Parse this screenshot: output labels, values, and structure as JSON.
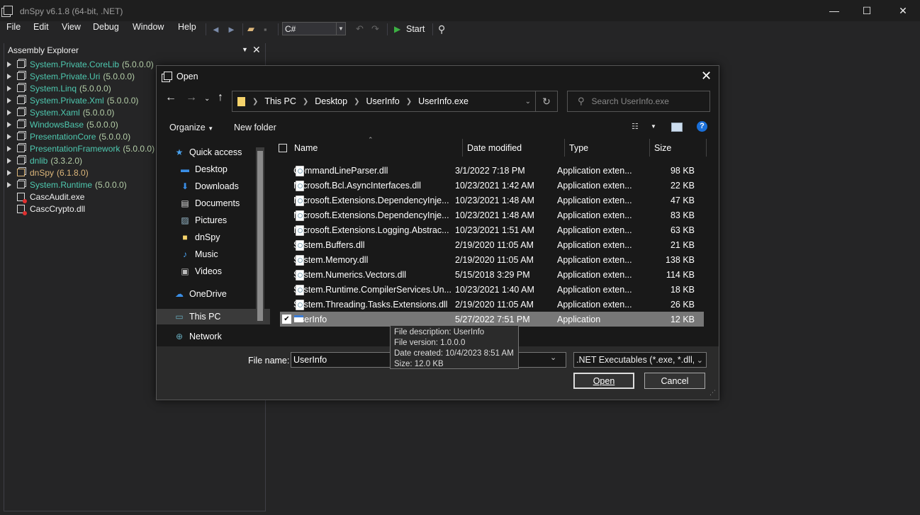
{
  "window": {
    "title": "dnSpy v6.1.8 (64-bit, .NET)",
    "minimize": "—",
    "maximize": "☐",
    "close": "✕"
  },
  "menu": [
    "File",
    "Edit",
    "View",
    "Debug",
    "Window",
    "Help"
  ],
  "toolbar": {
    "language": "C#",
    "start_label": "Start"
  },
  "explorer": {
    "title": "Assembly Explorer",
    "items": [
      {
        "name": "System.Private.CoreLib",
        "version": "(5.0.0.0)",
        "kind": "asm"
      },
      {
        "name": "System.Private.Uri",
        "version": "(5.0.0.0)",
        "kind": "asm"
      },
      {
        "name": "System.Linq",
        "version": "(5.0.0.0)",
        "kind": "asm"
      },
      {
        "name": "System.Private.Xml",
        "version": "(5.0.0.0)",
        "kind": "asm"
      },
      {
        "name": "System.Xaml",
        "version": "(5.0.0.0)",
        "kind": "asm"
      },
      {
        "name": "WindowsBase",
        "version": "(5.0.0.0)",
        "kind": "asm"
      },
      {
        "name": "PresentationCore",
        "version": "(5.0.0.0)",
        "kind": "asm"
      },
      {
        "name": "PresentationFramework",
        "version": "(5.0.0.0)",
        "kind": "asm"
      },
      {
        "name": "dnlib",
        "version": "(3.3.2.0)",
        "kind": "asm"
      },
      {
        "name": "dnSpy",
        "version": "(6.1.8.0)",
        "kind": "asm-yellow"
      },
      {
        "name": "System.Runtime",
        "version": "(5.0.0.0)",
        "kind": "asm"
      },
      {
        "name": "CascAudit.exe",
        "version": "",
        "kind": "err"
      },
      {
        "name": "CascCrypto.dll",
        "version": "",
        "kind": "err"
      }
    ]
  },
  "dialog": {
    "title": "Open",
    "breadcrumb": [
      "This PC",
      "Desktop",
      "UserInfo",
      "UserInfo.exe"
    ],
    "search_placeholder": "Search UserInfo.exe",
    "organize": "Organize",
    "new_folder": "New folder",
    "nav": [
      {
        "label": "Quick access",
        "icon": "star-icon",
        "pinned": false
      },
      {
        "label": "Desktop",
        "icon": "desktop-icon",
        "pinned": true
      },
      {
        "label": "Downloads",
        "icon": "download-icon",
        "pinned": true
      },
      {
        "label": "Documents",
        "icon": "document-icon",
        "pinned": true
      },
      {
        "label": "Pictures",
        "icon": "picture-icon",
        "pinned": true
      },
      {
        "label": "dnSpy",
        "icon": "folder-icon",
        "pinned": false
      },
      {
        "label": "Music",
        "icon": "music-icon",
        "pinned": false
      },
      {
        "label": "Videos",
        "icon": "video-icon",
        "pinned": false
      },
      {
        "label": "OneDrive",
        "icon": "cloud-icon",
        "pinned": false
      },
      {
        "label": "This PC",
        "icon": "pc-icon",
        "pinned": false
      },
      {
        "label": "Network",
        "icon": "network-icon",
        "pinned": false
      }
    ],
    "columns": {
      "name": "Name",
      "date": "Date modified",
      "type": "Type",
      "size": "Size"
    },
    "files": [
      {
        "name": "CommandLineParser.dll",
        "date": "3/1/2022 7:18 PM",
        "type": "Application exten...",
        "size": "98 KB"
      },
      {
        "name": "Microsoft.Bcl.AsyncInterfaces.dll",
        "date": "10/23/2021 1:42 AM",
        "type": "Application exten...",
        "size": "22 KB"
      },
      {
        "name": "Microsoft.Extensions.DependencyInje...",
        "date": "10/23/2021 1:48 AM",
        "type": "Application exten...",
        "size": "47 KB"
      },
      {
        "name": "Microsoft.Extensions.DependencyInje...",
        "date": "10/23/2021 1:48 AM",
        "type": "Application exten...",
        "size": "83 KB"
      },
      {
        "name": "Microsoft.Extensions.Logging.Abstrac...",
        "date": "10/23/2021 1:51 AM",
        "type": "Application exten...",
        "size": "63 KB"
      },
      {
        "name": "System.Buffers.dll",
        "date": "2/19/2020 11:05 AM",
        "type": "Application exten...",
        "size": "21 KB"
      },
      {
        "name": "System.Memory.dll",
        "date": "2/19/2020 11:05 AM",
        "type": "Application exten...",
        "size": "138 KB"
      },
      {
        "name": "System.Numerics.Vectors.dll",
        "date": "5/15/2018 3:29 PM",
        "type": "Application exten...",
        "size": "114 KB"
      },
      {
        "name": "System.Runtime.CompilerServices.Un...",
        "date": "10/23/2021 1:40 AM",
        "type": "Application exten...",
        "size": "18 KB"
      },
      {
        "name": "System.Threading.Tasks.Extensions.dll",
        "date": "2/19/2020 11:05 AM",
        "type": "Application exten...",
        "size": "26 KB"
      },
      {
        "name": "UserInfo",
        "date": "5/27/2022 7:51 PM",
        "type": "Application",
        "size": "12 KB",
        "selected": true
      }
    ],
    "file_name_label": "File name:",
    "file_name_value": "UserInfo",
    "filter": ".NET Executables (*.exe, *.dll, *.",
    "open_label": "Open",
    "cancel_label": "Cancel",
    "tooltip": [
      "File description: UserInfo",
      "File version: 1.0.0.0",
      "Date created: 10/4/2023 8:51 AM",
      "Size: 12.0 KB"
    ]
  }
}
